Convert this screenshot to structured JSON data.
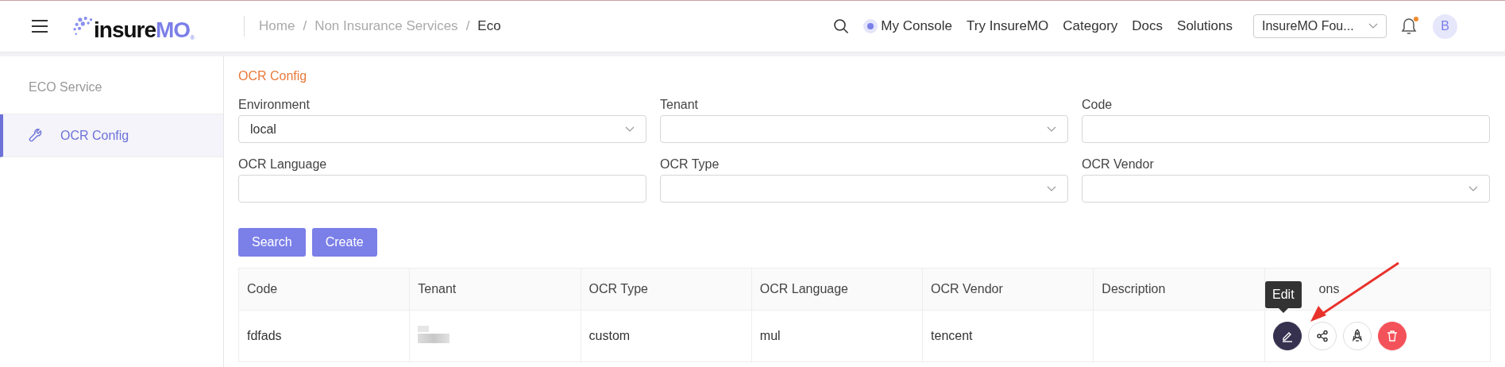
{
  "header": {
    "logo": {
      "part1": "insure",
      "part2": "MO",
      "mark": "®"
    },
    "breadcrumb": [
      "Home",
      "Non Insurance Services",
      "Eco"
    ],
    "breadcrumb_separator": "/",
    "nav": [
      {
        "label": "My Console",
        "kind": "console"
      },
      {
        "label": "Try InsureMO",
        "kind": "link"
      },
      {
        "label": "Category",
        "kind": "link"
      },
      {
        "label": "Docs",
        "kind": "link"
      },
      {
        "label": "Solutions",
        "kind": "link"
      }
    ],
    "tenant_select": "InsureMO Fou...",
    "notifications": true,
    "avatar": "B"
  },
  "sidebar": {
    "items": [
      {
        "label": "ECO Service",
        "kind": "group",
        "selected": false
      },
      {
        "label": "OCR Config",
        "kind": "item",
        "selected": true
      }
    ]
  },
  "page_title": "OCR Config",
  "filters": [
    {
      "label": "Environment",
      "kind": "select",
      "value": "local"
    },
    {
      "label": "Tenant",
      "kind": "select"
    },
    {
      "label": "Code",
      "kind": "input"
    },
    {
      "label": "OCR Language",
      "kind": "input"
    },
    {
      "label": "OCR Type",
      "kind": "select"
    },
    {
      "label": "OCR Vendor",
      "kind": "select"
    }
  ],
  "buttons": [
    "Search",
    "Create"
  ],
  "table": {
    "columns": [
      "Code",
      "Tenant",
      "OCR Type",
      "OCR Language",
      "OCR Vendor",
      "Description",
      "ons"
    ],
    "rows": [
      {
        "cells": [
          "fdfads",
          "",
          "custom",
          "mul",
          "tencent",
          ""
        ],
        "tenant_hidden": true
      }
    ]
  },
  "actions": [
    {
      "kind": "edit",
      "hovered": true
    },
    {
      "kind": "share",
      "hovered": false
    },
    {
      "kind": "deploy",
      "hovered": false
    },
    {
      "kind": "delete",
      "hovered": false
    }
  ],
  "tooltip": "Edit"
}
